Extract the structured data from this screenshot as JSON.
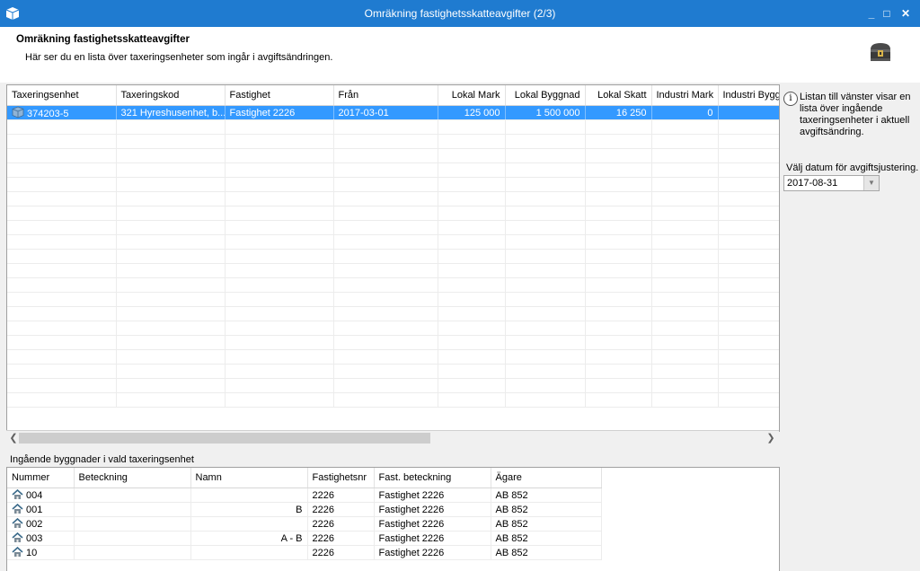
{
  "window": {
    "title": "Omräkning fastighetsskatteavgifter (2/3)",
    "minimize": "_",
    "maximize": "□",
    "close": "✕"
  },
  "header": {
    "title": "Omräkning fastighetsskatteavgifter",
    "subtitle": "Här ser du en lista över taxeringsenheter som ingår i avgiftsändringen."
  },
  "units_table": {
    "columns": [
      "Taxeringsenhet",
      "Taxeringskod",
      "Fastighet",
      "Från",
      "Lokal Mark",
      "Lokal Byggnad",
      "Lokal Skatt",
      "Industri Mark",
      "Industri Byggnad"
    ],
    "rows": [
      {
        "taxeringsenhet": "374203-5",
        "taxeringskod": "321 Hyreshusenhet, b...",
        "fastighet": "Fastighet 2226",
        "fran": "2017-03-01",
        "lokal_mark": "125 000",
        "lokal_byggnad": "1 500 000",
        "lokal_skatt": "16 250",
        "industri_mark": "0",
        "industri_byggnad": ""
      }
    ]
  },
  "side_panel": {
    "info_text": "Listan till vänster visar en lista över ingående taxeringsenheter i aktuell avgiftsändring.",
    "date_label": "Välj datum för avgiftsjustering.",
    "date_value": "2017-08-31"
  },
  "buildings": {
    "label": "Ingående byggnader i vald taxeringsenhet",
    "columns": [
      "Nummer",
      "Beteckning",
      "Namn",
      "Fastighetsnr",
      "Fast. beteckning",
      "Ägare"
    ],
    "rows": [
      {
        "nummer": "004",
        "namn": "",
        "fastighetsnr": "2226",
        "fast_beteckning": "Fastighet 2226",
        "agare": "AB 852"
      },
      {
        "nummer": "001",
        "namn": "B",
        "fastighetsnr": "2226",
        "fast_beteckning": "Fastighet 2226",
        "agare": "AB 852"
      },
      {
        "nummer": "002",
        "namn": "",
        "fastighetsnr": "2226",
        "fast_beteckning": "Fastighet 2226",
        "agare": "AB 852"
      },
      {
        "nummer": "003",
        "namn": "A - B",
        "fastighetsnr": "2226",
        "fast_beteckning": "Fastighet 2226",
        "agare": "AB 852"
      },
      {
        "nummer": "10",
        "namn": "",
        "fastighetsnr": "2226",
        "fast_beteckning": "Fastighet 2226",
        "agare": "AB 852"
      }
    ]
  },
  "colors": {
    "titlebar": "#1f7bd0",
    "selection": "#3399ff"
  }
}
